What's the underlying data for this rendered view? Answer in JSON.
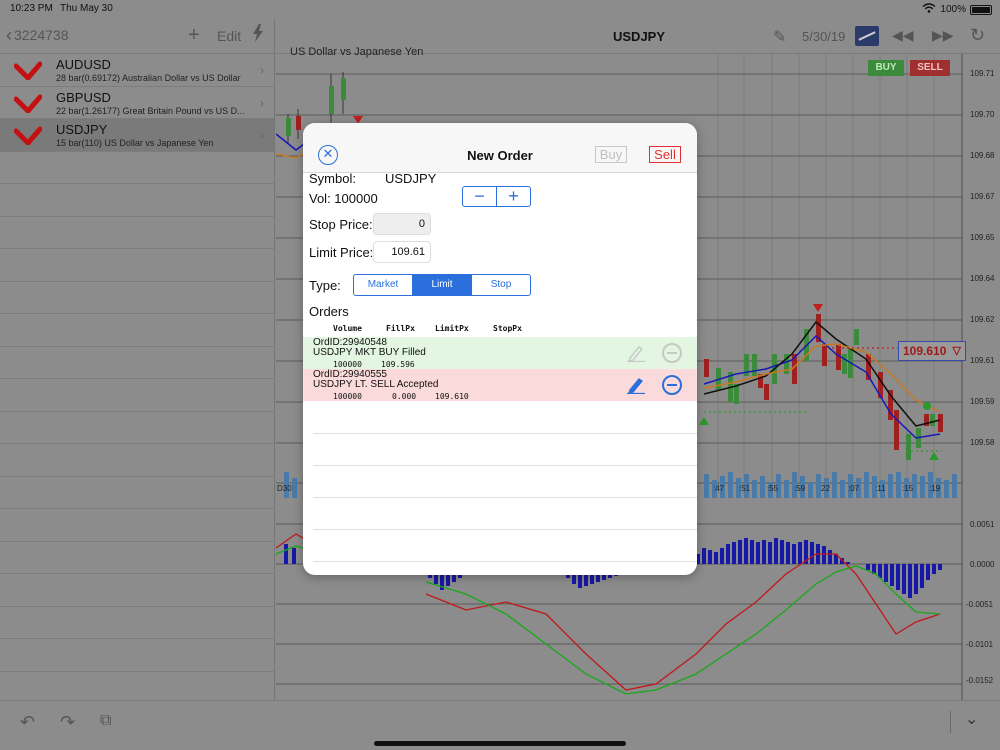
{
  "status": {
    "time": "10:23 PM",
    "date": "Thu May 30",
    "battery": "100%"
  },
  "left_nav": {
    "back_label": "3224738",
    "edit_label": "Edit"
  },
  "symbols": [
    {
      "name": "AUDUSD",
      "desc": "28 bar(0.69172) Australian Dollar vs US Dollar"
    },
    {
      "name": "GBPUSD",
      "desc": "22 bar(1.26177) Great Britain Pound vs US D..."
    },
    {
      "name": "USDJPY",
      "desc": "15 bar(110) US Dollar vs Japanese Yen"
    }
  ],
  "chart_header": {
    "title": "USDJPY",
    "date": "5/30/19"
  },
  "chart": {
    "label": "US Dollar vs Japanese Yen",
    "buy": "BUY",
    "sell": "SELL",
    "current_price": "109.610",
    "price_axis": [
      "109.71",
      "109.70",
      "109.68",
      "109.67",
      "109.65",
      "109.64",
      "109.62",
      "109.61",
      "109.59",
      "109.58"
    ],
    "macd_axis": [
      "0.0051",
      "0.0000",
      "-0.0051",
      "-0.0101",
      "-0.0152"
    ],
    "time_axis": [
      ":47",
      ":51",
      ":55",
      ":59",
      "22",
      ":07",
      ":11",
      ":15",
      ":19"
    ],
    "left_time_label": "D30"
  },
  "modal": {
    "title": "New Order",
    "buy_label": "Buy",
    "sell_label": "Sell",
    "symbol_label": "Symbol:",
    "symbol_value": "USDJPY",
    "vol_label": "Vol: 100000",
    "stop_label": "Stop Price:",
    "stop_value": "0",
    "limit_label": "Limit Price:",
    "limit_value": "109.61",
    "type_label": "Type:",
    "types": [
      "Market",
      "Limit",
      "Stop"
    ],
    "orders_label": "Orders",
    "columns": [
      "Volume",
      "FillPx",
      "LimitPx",
      "StopPx"
    ],
    "orders": [
      {
        "id": "OrdID:29940548",
        "desc": "USDJPY MKT BUY Filled",
        "volume": "100000",
        "fill": "109.596",
        "limit": "",
        "stop": ""
      },
      {
        "id": "OrdID:29940555",
        "desc": "USDJPY LT. SELL Accepted",
        "volume": "100000",
        "fill": "0.000",
        "limit": "109.610",
        "stop": ""
      }
    ]
  },
  "colors": {
    "accent": "#2a6fdb",
    "sell_red": "#e03030",
    "filled_green_bg": "#e2f6e1",
    "accepted_red_bg": "#fadada"
  }
}
